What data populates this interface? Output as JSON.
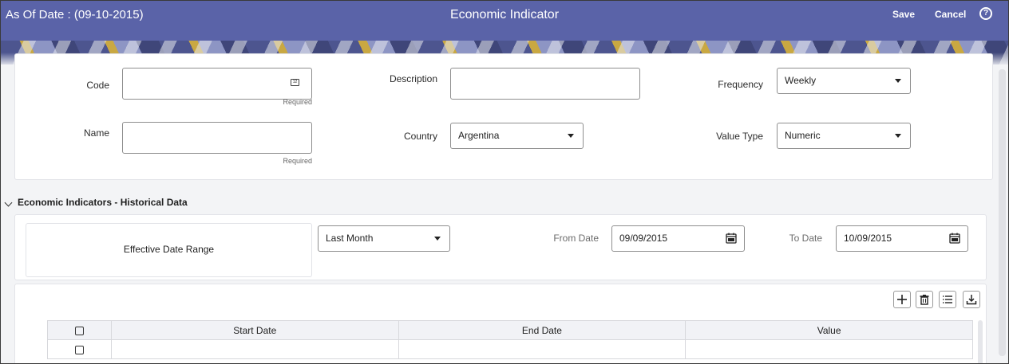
{
  "header": {
    "as_of_date": "As Of Date : (09-10-2015)",
    "title": "Economic Indicator",
    "save_label": "Save",
    "cancel_label": "Cancel",
    "help_glyph": "?",
    "color": "#5a63a8"
  },
  "form": {
    "code": {
      "label": "Code",
      "value": "",
      "hint": "Required",
      "icon": "code-entry-icon",
      "icon_glyph": "12"
    },
    "name": {
      "label": "Name",
      "value": "",
      "hint": "Required"
    },
    "description": {
      "label": "Description",
      "value": ""
    },
    "country": {
      "label": "Country",
      "value": "Argentina"
    },
    "frequency": {
      "label": "Frequency",
      "value": "Weekly"
    },
    "value_type": {
      "label": "Value Type",
      "value": "Numeric"
    }
  },
  "historical": {
    "section_title": "Economic Indicators - Historical Data",
    "effective_date_range_label": "Effective Date Range",
    "range_select": "Last Month",
    "from_date_label": "From Date",
    "from_date": "09/09/2015",
    "to_date_label": "To Date",
    "to_date": "10/09/2015",
    "toolbar": [
      "add-icon",
      "delete-icon",
      "column-list-icon",
      "download-icon"
    ],
    "columns": [
      "Start Date",
      "End Date",
      "Value"
    ],
    "rows": [
      {
        "start_date": "",
        "end_date": "",
        "value": ""
      }
    ]
  }
}
